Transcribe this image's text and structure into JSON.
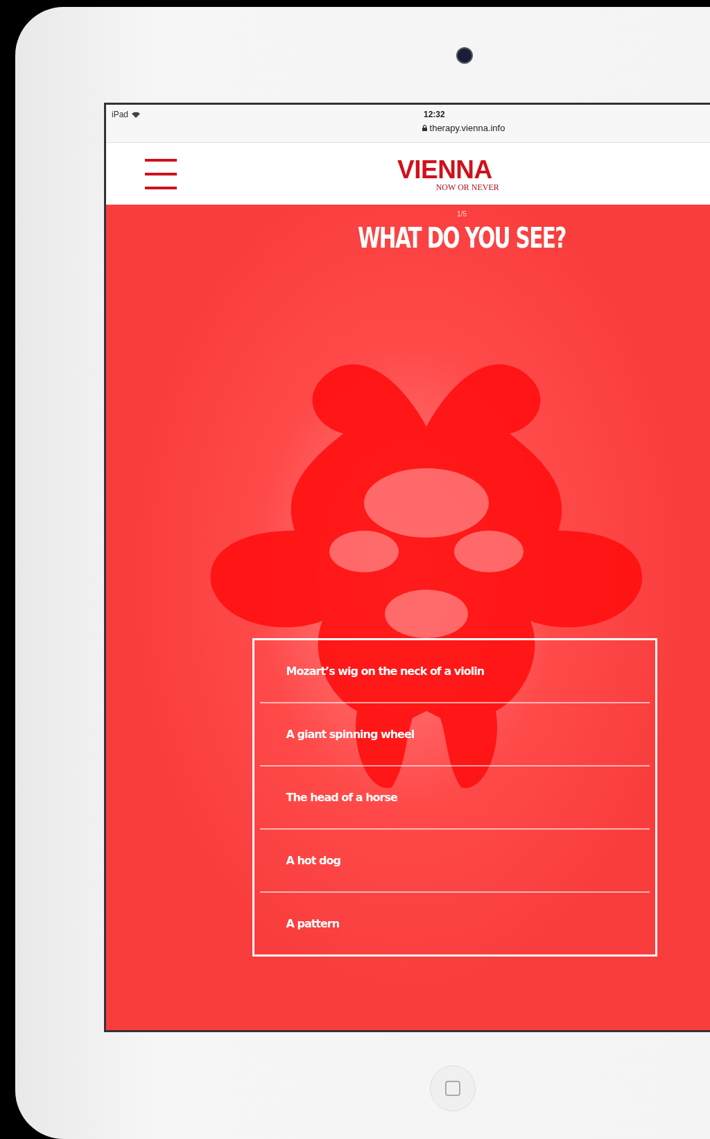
{
  "status_bar": {
    "device": "iPad",
    "time": "12:32",
    "url": "therapy.vienna.info"
  },
  "header": {
    "logo": "VIENNA",
    "tagline": "NOW OR NEVER"
  },
  "quiz": {
    "progress": "1/5",
    "question": "WHAT DO YOU SEE?",
    "answers": [
      "Mozart’s wig on the neck of a violin",
      "A giant spinning wheel",
      "The head of a horse",
      "A hot dog",
      "A pattern"
    ]
  }
}
